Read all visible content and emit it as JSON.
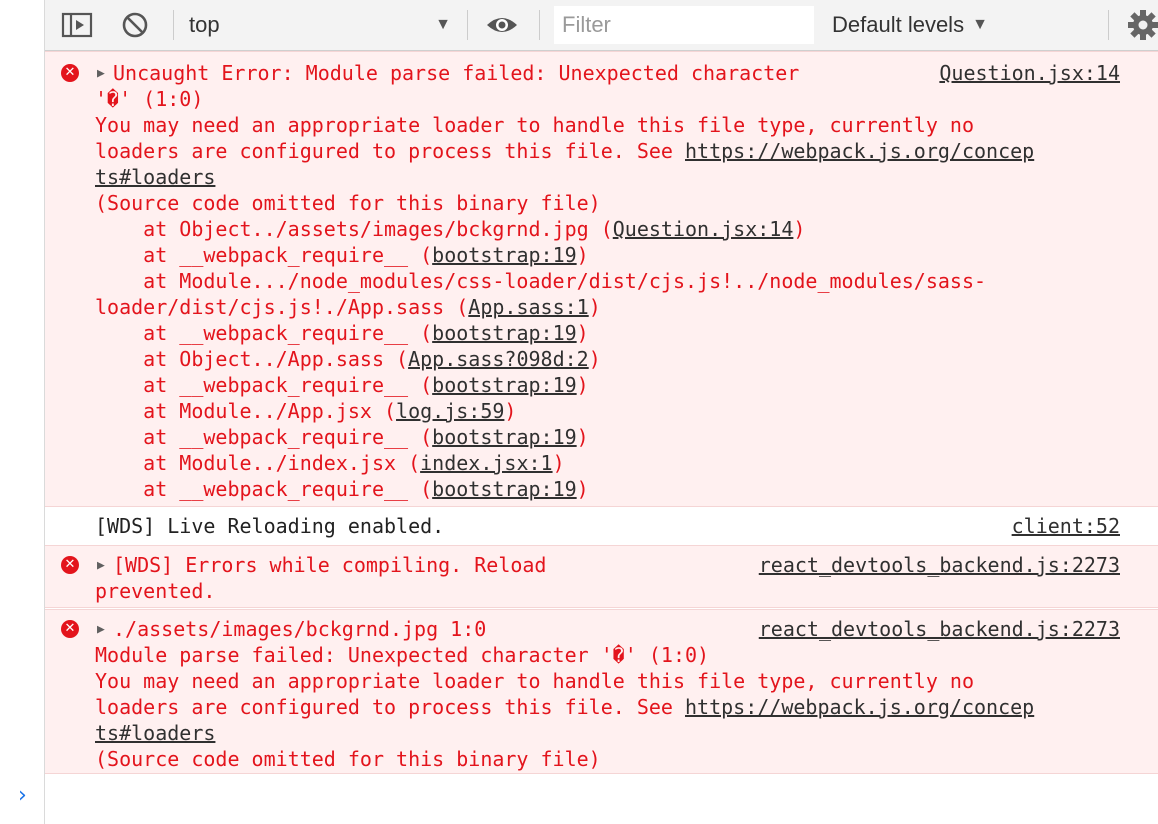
{
  "toolbar": {
    "context_value": "top",
    "filter_placeholder": "Filter",
    "levels_label": "Default levels",
    "dropdown_glyph": "▼"
  },
  "messages": [
    {
      "level": "error",
      "source": "Question.jsx:14",
      "first_line": "Uncaught Error: Module parse failed: Unexpected character",
      "lines": [
        "'�' (1:0)",
        "You may need an appropriate loader to handle this file type, currently no",
        "loaders are configured to process this file. See ",
        "https://webpack.js.org/concep",
        "ts#loaders",
        "(Source code omitted for this binary file)"
      ],
      "stack": [
        {
          "text": "    at Object../assets/images/bckgrnd.jpg (",
          "link": "Question.jsx:14",
          "tail": ")"
        },
        {
          "text": "    at __webpack_require__ (",
          "link": "bootstrap:19",
          "tail": ")"
        },
        {
          "text": "    at Module.../node_modules/css-loader/dist/cjs.js!../node_modules/sass-",
          "link": "",
          "tail": ""
        },
        {
          "text": "loader/dist/cjs.js!./App.sass (",
          "link": "App.sass:1",
          "tail": ")"
        },
        {
          "text": "    at __webpack_require__ (",
          "link": "bootstrap:19",
          "tail": ")"
        },
        {
          "text": "    at Object../App.sass (",
          "link": "App.sass?098d:2",
          "tail": ")"
        },
        {
          "text": "    at __webpack_require__ (",
          "link": "bootstrap:19",
          "tail": ")"
        },
        {
          "text": "    at Module../App.jsx (",
          "link": "log.js:59",
          "tail": ")"
        },
        {
          "text": "    at __webpack_require__ (",
          "link": "bootstrap:19",
          "tail": ")"
        },
        {
          "text": "    at Module../index.jsx (",
          "link": "index.jsx:1",
          "tail": ")"
        },
        {
          "text": "    at __webpack_require__ (",
          "link": "bootstrap:19",
          "tail": ")"
        }
      ]
    },
    {
      "level": "info",
      "text": "[WDS] Live Reloading enabled.",
      "source": "client:52"
    },
    {
      "level": "error",
      "first_line": "[WDS] Errors while compiling. Reload",
      "line2": "prevented.",
      "source": "react_devtools_backend.js:2273"
    },
    {
      "level": "error",
      "first_line": "./assets/images/bckgrnd.jpg 1:0",
      "source": "react_devtools_backend.js:2273",
      "lines": [
        "Module parse failed: Unexpected character '�' (1:0)",
        "You may need an appropriate loader to handle this file type, currently no",
        "loaders are configured to process this file. See ",
        "https://webpack.js.org/concep",
        "ts#loaders",
        "(Source code omitted for this binary file)"
      ]
    }
  ],
  "prompt_glyph": "›",
  "icons": {
    "error": "✕",
    "expand": "▶"
  },
  "colors": {
    "error_text": "#e3141c",
    "error_bg": "#fff0f0",
    "prompt": "#1a73e8"
  }
}
